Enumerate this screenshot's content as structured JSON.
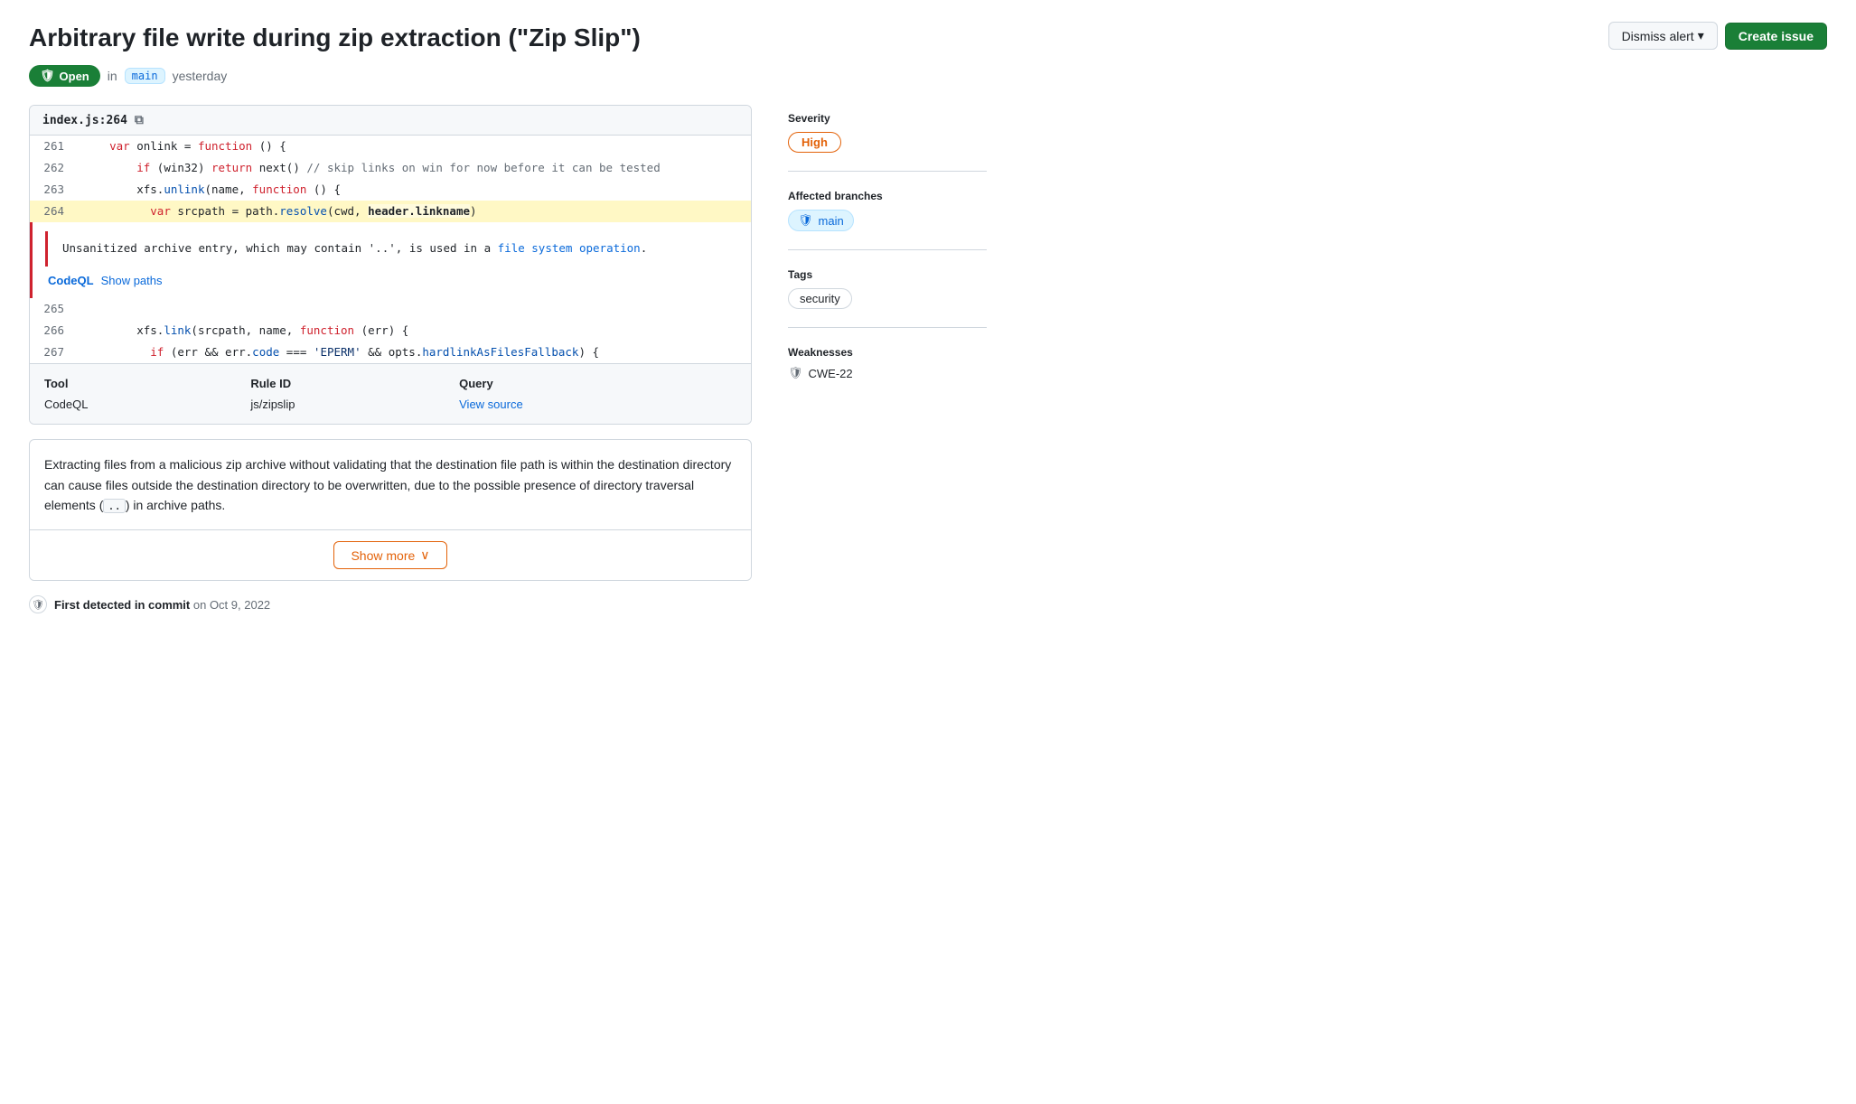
{
  "header": {
    "title": "Arbitrary file write during zip extraction (\"Zip Slip\")",
    "status": "Open",
    "branch": "main",
    "time": "yesterday"
  },
  "actions": {
    "dismiss_label": "Dismiss alert",
    "create_label": "Create issue"
  },
  "code": {
    "filename": "index.js:264",
    "lines": [
      {
        "num": "261",
        "content": "    var onlink = function () {",
        "type": "normal"
      },
      {
        "num": "262",
        "content": "        if (win32) return next() // skip links on win for now before it can be tested",
        "type": "normal"
      },
      {
        "num": "263",
        "content": "        xfs.unlink(name, function () {",
        "type": "normal"
      },
      {
        "num": "264",
        "content": "          var srcpath = path.resolve(cwd, header.linkname)",
        "type": "highlight"
      }
    ],
    "alert_message": "Unsanitized archive entry, which may contain '..', is used in a file system operation.",
    "codeql_label": "CodeQL",
    "show_paths_label": "Show paths",
    "lines_after": [
      {
        "num": "265",
        "content": "",
        "type": "normal"
      },
      {
        "num": "266",
        "content": "        xfs.link(srcpath, name, function (err) {",
        "type": "normal"
      },
      {
        "num": "267",
        "content": "          if (err && err.code === 'EPERM' && opts.hardlinkAsFilesFallback) {",
        "type": "normal"
      }
    ]
  },
  "tool_table": {
    "headers": [
      "Tool",
      "Rule ID",
      "Query"
    ],
    "rows": [
      {
        "tool": "CodeQL",
        "rule_id": "js/zipslip",
        "query": "View source"
      }
    ]
  },
  "description": {
    "text_parts": [
      "Extracting files from a malicious zip archive without validating that the destination file path is within the destination directory can cause files outside the destination directory to be overwritten, due to the possible presence of directory traversal elements (",
      " ) in archive paths."
    ],
    "code_inline": "..",
    "show_more_label": "Show more",
    "chevron": "∨"
  },
  "footer": {
    "detected_label": "First detected in commit",
    "date": "on Oct 9, 2022"
  },
  "sidebar": {
    "severity_label": "Severity",
    "severity_value": "High",
    "affected_label": "Affected branches",
    "branch": "main",
    "tags_label": "Tags",
    "tag": "security",
    "weaknesses_label": "Weaknesses",
    "cwe": "CWE-22"
  }
}
